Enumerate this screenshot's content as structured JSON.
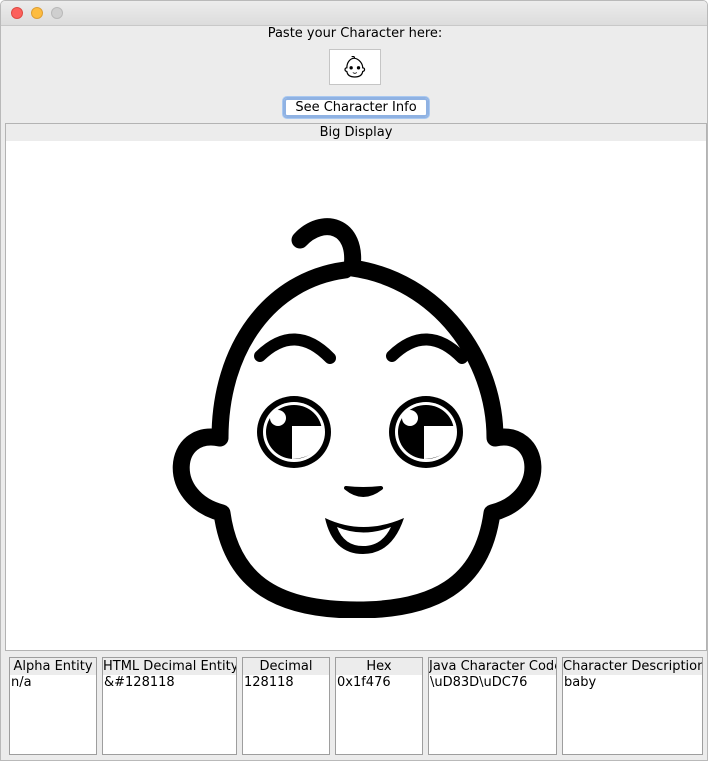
{
  "window": {
    "prompt": "Paste your Character here:",
    "button_label": "See Character Info",
    "character_icon": "baby-face-emoji-icon"
  },
  "display": {
    "header": "Big Display",
    "icon": "baby-face-icon"
  },
  "fields": [
    {
      "title": "Alpha Entity",
      "value": "n/a"
    },
    {
      "title": "HTML Decimal Entity",
      "value": "&#128118"
    },
    {
      "title": "Decimal",
      "value": "128118"
    },
    {
      "title": "Hex",
      "value": "0x1f476"
    },
    {
      "title": "Java Character Code",
      "value": "\\uD83D\\uDC76"
    },
    {
      "title": "Character Description",
      "value": "baby"
    }
  ]
}
